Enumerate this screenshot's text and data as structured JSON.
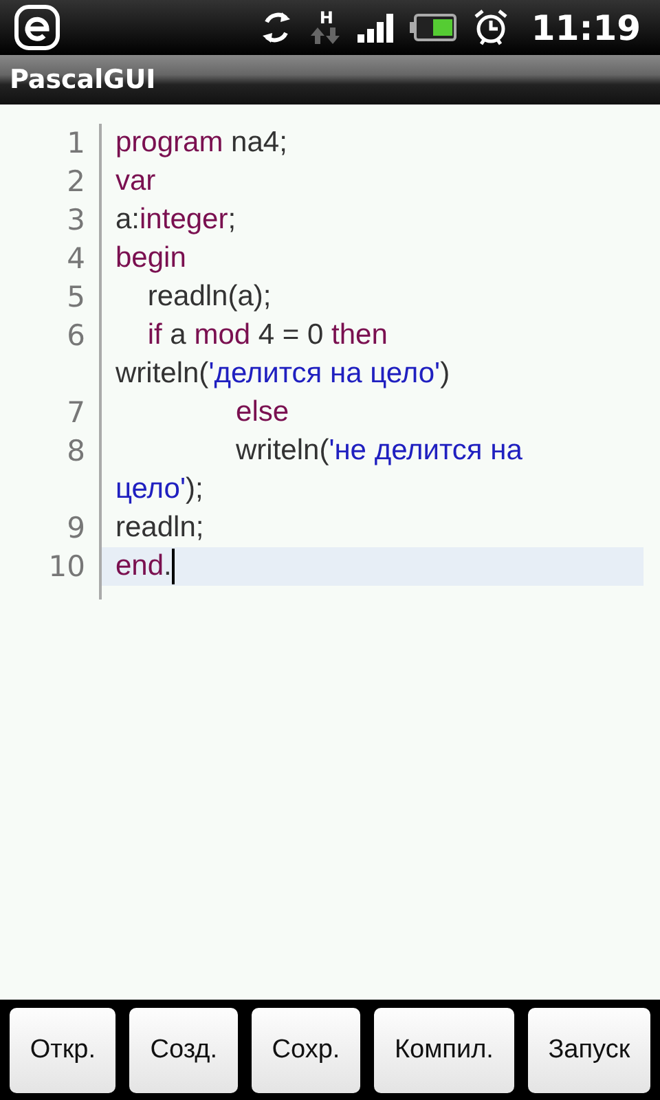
{
  "status_bar": {
    "time": "11:19",
    "network_type": "H"
  },
  "title_bar": {
    "title": "PascalGUI"
  },
  "editor": {
    "lines": [
      {
        "number": "1",
        "current": false,
        "tokens": [
          {
            "kind": "keyword",
            "text": "program"
          },
          {
            "kind": "plain",
            "text": " na4;"
          }
        ]
      },
      {
        "number": "2",
        "current": false,
        "tokens": [
          {
            "kind": "keyword",
            "text": "var"
          }
        ]
      },
      {
        "number": "3",
        "current": false,
        "tokens": [
          {
            "kind": "plain",
            "text": "a:"
          },
          {
            "kind": "keyword",
            "text": "integer"
          },
          {
            "kind": "plain",
            "text": ";"
          }
        ]
      },
      {
        "number": "4",
        "current": false,
        "tokens": [
          {
            "kind": "keyword",
            "text": "begin"
          }
        ]
      },
      {
        "number": "5",
        "current": false,
        "tokens": [
          {
            "kind": "plain",
            "text": "    readln(a);"
          }
        ]
      },
      {
        "number": "6",
        "current": false,
        "tokens": [
          {
            "kind": "keyword",
            "text": "    if"
          },
          {
            "kind": "plain",
            "text": " a "
          },
          {
            "kind": "keyword",
            "text": "mod"
          },
          {
            "kind": "plain",
            "text": " 4 = 0 "
          },
          {
            "kind": "keyword",
            "text": "then"
          },
          {
            "kind": "wrap"
          },
          {
            "kind": "plain",
            "text": "writeln("
          },
          {
            "kind": "string",
            "text": "'делится на цело'"
          },
          {
            "kind": "plain",
            "text": ")"
          }
        ]
      },
      {
        "number": "7",
        "current": false,
        "tokens": [
          {
            "kind": "keyword",
            "text": "               else"
          }
        ]
      },
      {
        "number": "8",
        "current": false,
        "tokens": [
          {
            "kind": "plain",
            "text": "               writeln("
          },
          {
            "kind": "string",
            "text": "'не делится на"
          },
          {
            "kind": "wrap"
          },
          {
            "kind": "string",
            "text": "цело'"
          },
          {
            "kind": "plain",
            "text": ");"
          }
        ]
      },
      {
        "number": "9",
        "current": false,
        "tokens": [
          {
            "kind": "plain",
            "text": "readln;"
          }
        ]
      },
      {
        "number": "10",
        "current": true,
        "tokens": [
          {
            "kind": "keyword",
            "text": "end"
          },
          {
            "kind": "plain",
            "text": "."
          }
        ]
      }
    ]
  },
  "buttons": [
    {
      "label": "Откр."
    },
    {
      "label": "Созд."
    },
    {
      "label": "Сохр."
    },
    {
      "label": "Компил."
    },
    {
      "label": "Запуск"
    }
  ]
}
